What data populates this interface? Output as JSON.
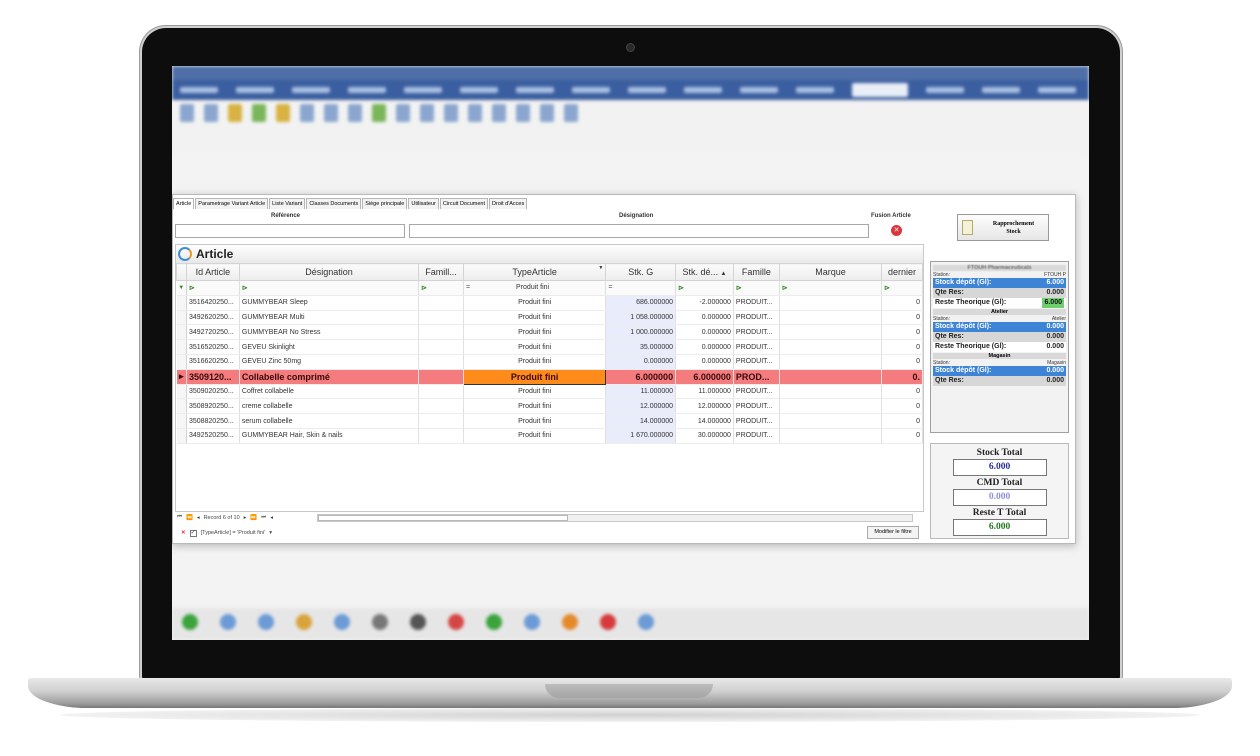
{
  "tabs": [
    {
      "label": "Article"
    },
    {
      "label": "Parametrage Variant Article"
    },
    {
      "label": "Liste Variant"
    },
    {
      "label": "Classes Documents"
    },
    {
      "label": "Siège principale"
    },
    {
      "label": "Utilisateur"
    },
    {
      "label": "Circuit Document"
    },
    {
      "label": "Droit d'Acces"
    }
  ],
  "search": {
    "reference_label": "Référence",
    "designation_label": "Désignation",
    "fusion_label": "Fusion Article",
    "fusion_icon": "close-circle-icon"
  },
  "rapprochement_button": {
    "label_line1": "Rapprochement",
    "label_line2": "Stock",
    "icon": "document-icon"
  },
  "grid": {
    "title": "Article",
    "columns": [
      "Id Article",
      "Désignation",
      "Famill...",
      "TypeArticle",
      "Stk. G",
      "Stk. dé...",
      "Famille",
      "Marque",
      "dernier"
    ],
    "filter_row": {
      "type_eq": "=",
      "type_value": "Produit fini",
      "stk_eq": "="
    },
    "rows": [
      {
        "id": "3516420250...",
        "des": "GUMMYBEAR Sleep",
        "type": "Produit fini",
        "stkg": "686.000000",
        "stkd": "-2.000000",
        "fam": "PRODUIT...",
        "last": "0"
      },
      {
        "id": "3492620250...",
        "des": "GUMMYBEAR Multi",
        "type": "Produit fini",
        "stkg": "1 058.000000",
        "stkd": "0.000000",
        "fam": "PRODUIT...",
        "last": "0"
      },
      {
        "id": "3492720250...",
        "des": "GUMMYBEAR No Stress",
        "type": "Produit fini",
        "stkg": "1 000.000000",
        "stkd": "0.000000",
        "fam": "PRODUIT...",
        "last": "0"
      },
      {
        "id": "3516520250...",
        "des": "GEVEU Skinlight",
        "type": "Produit fini",
        "stkg": "35.000000",
        "stkd": "0.000000",
        "fam": "PRODUIT...",
        "last": "0"
      },
      {
        "id": "3516620250...",
        "des": "GEVEU Zinc 50mg",
        "type": "Produit fini",
        "stkg": "0.000000",
        "stkd": "0.000000",
        "fam": "PRODUIT...",
        "last": "0"
      },
      {
        "id": "3509120...",
        "des": "Collabelle comprimé",
        "type": "Produit fini",
        "stkg": "6.000000",
        "stkd": "6.000000",
        "fam": "PROD...",
        "last": "0."
      },
      {
        "id": "3509020250...",
        "des": "Coffret collabelle",
        "type": "Produit fini",
        "stkg": "11.000000",
        "stkd": "11.000000",
        "fam": "PRODUIT...",
        "last": "0"
      },
      {
        "id": "3508920250...",
        "des": "creme collabelle",
        "type": "Produit fini",
        "stkg": "12.000000",
        "stkd": "12.000000",
        "fam": "PRODUIT...",
        "last": "0"
      },
      {
        "id": "3508820250...",
        "des": "serum collabelle",
        "type": "Produit fini",
        "stkg": "14.000000",
        "stkd": "14.000000",
        "fam": "PRODUIT...",
        "last": "0"
      },
      {
        "id": "3492520250...",
        "des": "GUMMYBEAR Hair, Skin & nails",
        "type": "Produit fini",
        "stkg": "1 670.000000",
        "stkd": "30.000000",
        "fam": "PRODUIT...",
        "last": "0"
      }
    ]
  },
  "navigator": {
    "record_text": "Record 6 of 10"
  },
  "filter_bar": {
    "expression": "[TypeArticle] = 'Produit fini'",
    "modify_button": "Modifier le filtre"
  },
  "stock_panel": {
    "group1_title": "FTOUH Pharmaceuticals",
    "station_label": "Station:",
    "group1_station": "FTOUH P",
    "stock_depot_label": "Stock dépôt (Gl):",
    "qte_res_label": "Qte Res:",
    "reste_label": "Reste Theorique (Gl):",
    "group1": {
      "stock": "6.000",
      "qte": "0.000",
      "reste": "6.000"
    },
    "group2_title": "Atelier",
    "group2_station": "Atelier",
    "group2": {
      "stock": "0.000",
      "qte": "0.000",
      "reste": "0.000"
    },
    "group3_title": "Magasin",
    "group3_station": "Magasin",
    "group3": {
      "stock": "0.000",
      "qte": "0.000"
    }
  },
  "totals": {
    "stock_label": "Stock Total",
    "stock_value": "6.000",
    "cmd_label": "CMD Total",
    "cmd_value": "0.000",
    "reste_label": "Reste T Total",
    "reste_value": "6.000"
  },
  "colors": {
    "selected_row": "#f47b7e",
    "selected_type_cell": "#ff8c1a",
    "panel_blue": "#3d84d6",
    "menu_blue": "#3a5e9f"
  }
}
